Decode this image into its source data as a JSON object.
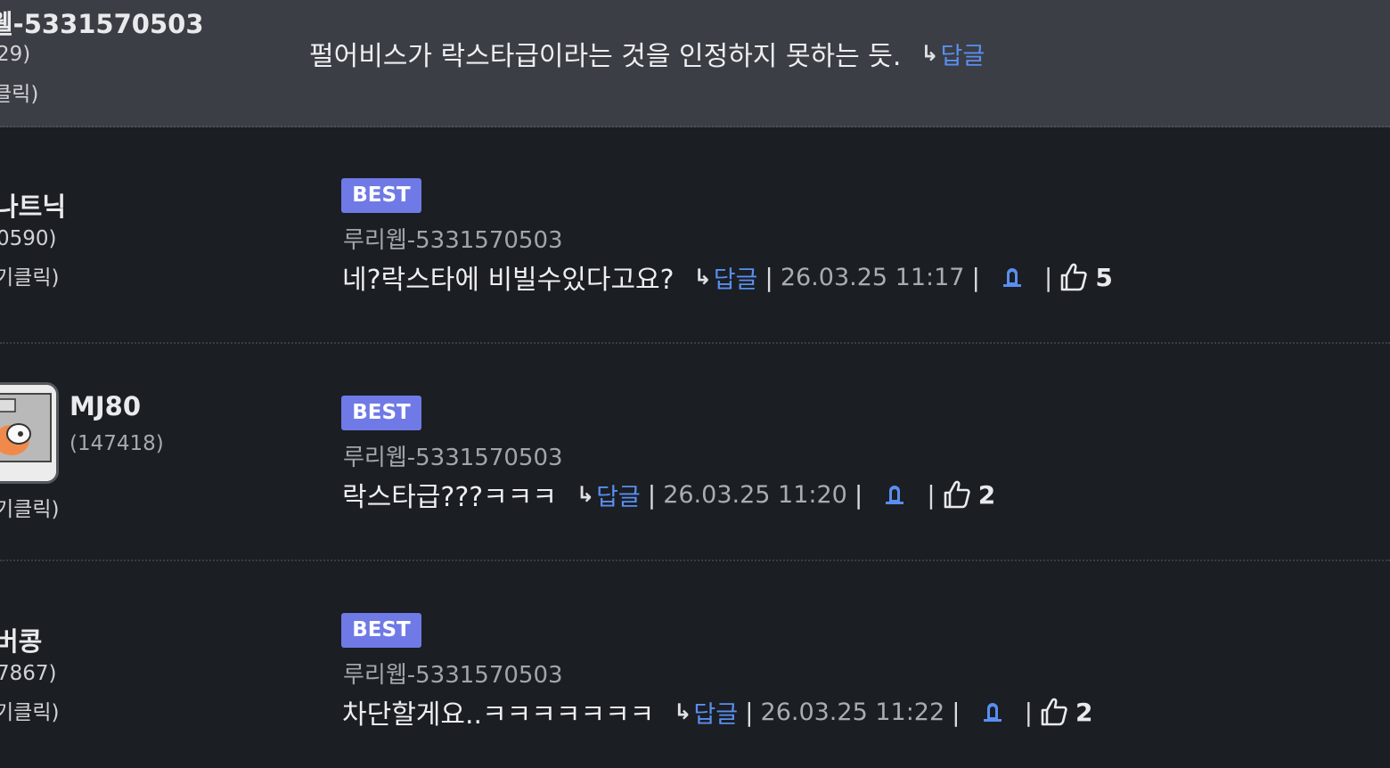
{
  "colors": {
    "background": "#1b1e23",
    "top_row_background": "#3b3e44",
    "badge": "#6f7ae6",
    "link": "#5a8ef0"
  },
  "top_comment": {
    "nick": "웰-5331570503",
    "level": "29)",
    "click_label": "클릭)",
    "text": "펄어비스가 락스타급이라는 것을 인정하지 못하는 듯.",
    "reply_arrow": "↳",
    "reply_label": "답글"
  },
  "comments": [
    {
      "nick": "나트닉",
      "level": "0590)",
      "click_label": "기클릭)",
      "badge": "BEST",
      "source": "루리웹-5331570503",
      "text": "네?락스타에 비빌수있다고요?",
      "reply_arrow": "↳",
      "reply_label": "답글",
      "sep": "|",
      "time": "26.03.25 11:17",
      "likes": "5",
      "bell_icon": "bell-icon",
      "like_icon": "thumbs-up-icon"
    },
    {
      "nick": "MJ80",
      "level": "(147418)",
      "click_label": "기클릭)",
      "badge": "BEST",
      "source": "루리웹-5331570503",
      "text": "락스타급???ㅋㅋㅋ",
      "reply_arrow": "↳",
      "reply_label": "답글",
      "sep": "|",
      "time": "26.03.25 11:20",
      "likes": "2",
      "bell_icon": "bell-icon",
      "like_icon": "thumbs-up-icon"
    },
    {
      "nick": "버콩",
      "level": "7867)",
      "click_label": "기클릭)",
      "badge": "BEST",
      "source": "루리웹-5331570503",
      "text": "차단할게요..ㅋㅋㅋㅋㅋㅋㅋ",
      "reply_arrow": "↳",
      "reply_label": "답글",
      "sep": "|",
      "time": "26.03.25 11:22",
      "likes": "2",
      "bell_icon": "bell-icon",
      "like_icon": "thumbs-up-icon"
    }
  ]
}
